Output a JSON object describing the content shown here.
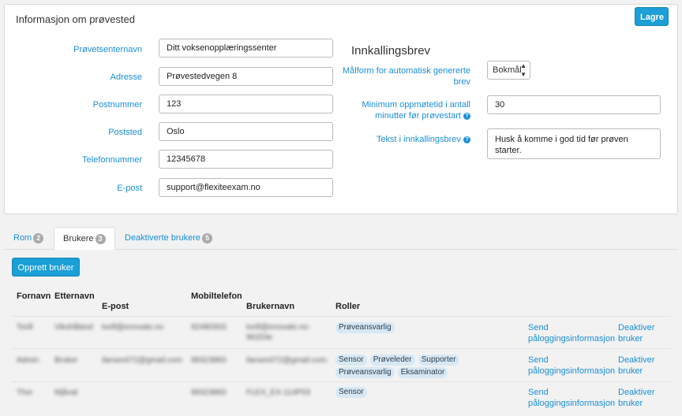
{
  "panel": {
    "title": "Informasjon om prøvested",
    "save_label": "Lagre",
    "fields": [
      {
        "label": "Prøvetsenternavn",
        "value": "Ditt voksenopplæringssenter"
      },
      {
        "label": "Adresse",
        "value": "Prøvestedvegen 8"
      },
      {
        "label": "Postnummer",
        "value": "123"
      },
      {
        "label": "Poststed",
        "value": "Oslo"
      },
      {
        "label": "Telefonnummer",
        "value": "12345678"
      },
      {
        "label": "E-post",
        "value": "support@flexiteexam.no"
      }
    ],
    "letter": {
      "title": "Innkallingsbrev",
      "language_label_1": "Målform for automatisk genererte",
      "language_label_2": "brev",
      "language_value": "Bokmål",
      "min_time_label_1": "Minimum oppmøtetid i antall",
      "min_time_label_2": "minutter før prøvestart",
      "min_time_value": "30",
      "text_label": "Tekst i innkallingsbrev",
      "text_value": "Husk å komme i god tid før prøven starter."
    }
  },
  "tabs": [
    {
      "label": "Rom",
      "count": "2"
    },
    {
      "label": "Brukere",
      "count": "3"
    },
    {
      "label": "Deaktiverte brukere",
      "count": "5"
    }
  ],
  "create_user_label": "Opprett bruker",
  "table": {
    "headers": {
      "first_name": "Fornavn",
      "last_name": "Etternavn",
      "email": "E-post",
      "mobile": "Mobiltelefon",
      "username": "Brukernavn",
      "roles": "Roller"
    },
    "rows": [
      {
        "first_name": "Torill",
        "last_name": "Vikshåland",
        "email": "torill@enovate.no",
        "mobile": "92480303",
        "username_1": "torill@enovate.no-",
        "username_2": "96203e",
        "roles": [
          "Prøveansvarlig"
        ],
        "send_1": "Send",
        "send_2": "påloggingsinformasjon",
        "deact_1": "Deaktiver",
        "deact_2": "bruker"
      },
      {
        "first_name": "Admin",
        "last_name": "Bruker",
        "email": "ilarsen072@gmail.com",
        "mobile": "99323883",
        "username_1": "ilarsen072@gmail.com",
        "username_2": "",
        "roles": [
          "Sensor",
          "Prøveleder",
          "Supporter",
          "Prøveansvarlig",
          "Eksaminator"
        ],
        "send_1": "Send",
        "send_2": "påloggingsinformasjon",
        "deact_1": "Deaktiver",
        "deact_2": "bruker"
      },
      {
        "first_name": "Thor",
        "last_name": "Mjåvat",
        "email": "",
        "mobile": "99323883",
        "username_1": "FLEX_EX-114P03",
        "username_2": "",
        "roles": [
          "Sensor"
        ],
        "send_1": "Send",
        "send_2": "påloggingsinformasjon",
        "deact_1": "Deaktiver",
        "deact_2": "bruker"
      }
    ]
  },
  "colors": {
    "accent": "#1a9fd6",
    "link": "#1a8fd6",
    "role_bg": "#d7e8f4",
    "page_bg": "#f2f2f2"
  }
}
